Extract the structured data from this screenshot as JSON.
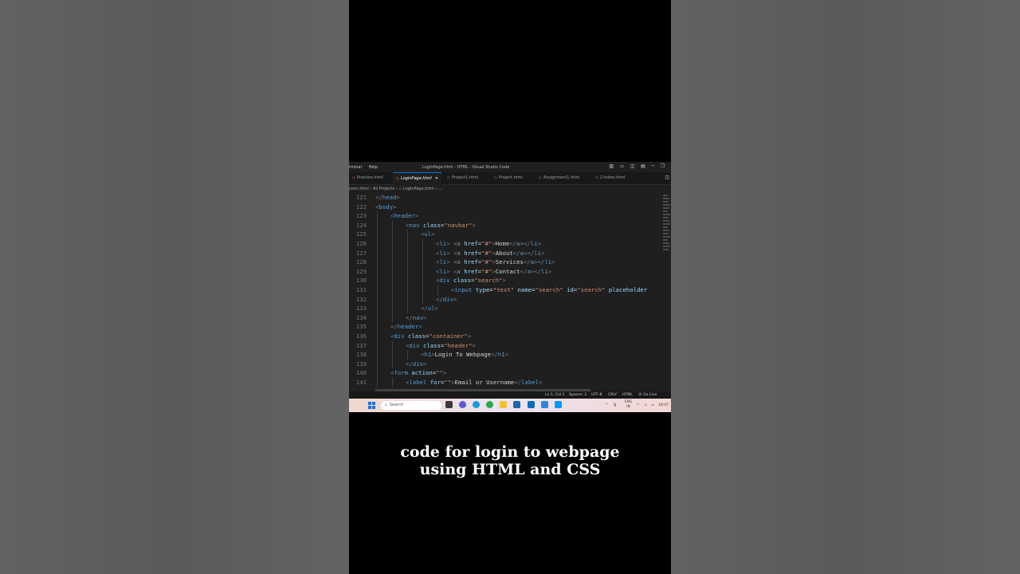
{
  "window": {
    "menu": [
      "rminal",
      "Help"
    ],
    "title": "LoginPage.html - HTML - Visual Studio Code",
    "controls": [
      "▥",
      "▭",
      "◫",
      "▤",
      "─",
      "❐"
    ]
  },
  "tabs": [
    {
      "label": "Practice.html",
      "active": false
    },
    {
      "label": "LoginPage.html",
      "active": true
    },
    {
      "label": "Project1.html",
      "active": false
    },
    {
      "label": "Project.html",
      "active": false
    },
    {
      "label": "Assignment1.html",
      "active": false
    },
    {
      "label": "2-index.html",
      "active": false
    }
  ],
  "breadcrumb": {
    "part1": "conc.html",
    "part2": "All Projects",
    "part3": "LoginPage.html",
    "part4": "..."
  },
  "code": {
    "lines": [
      {
        "n": "121",
        "indent": 0,
        "t": [
          [
            "pn",
            "</"
          ],
          [
            "tg",
            "head"
          ],
          [
            "pn",
            ">"
          ]
        ]
      },
      {
        "n": "122",
        "indent": 0,
        "t": [
          [
            "pn",
            "<"
          ],
          [
            "tg",
            "body"
          ],
          [
            "pn",
            ">"
          ]
        ]
      },
      {
        "n": "123",
        "indent": 1,
        "t": [
          [
            "pn",
            "<"
          ],
          [
            "tg",
            "header"
          ],
          [
            "pn",
            ">"
          ]
        ]
      },
      {
        "n": "124",
        "indent": 2,
        "t": [
          [
            "pn",
            "<"
          ],
          [
            "tg",
            "nav"
          ],
          [
            "tx",
            " "
          ],
          [
            "at",
            "class"
          ],
          [
            "tx",
            "="
          ],
          [
            "st",
            "\"navbar\""
          ],
          [
            "pn",
            ">"
          ]
        ]
      },
      {
        "n": "125",
        "indent": 3,
        "t": [
          [
            "pn",
            "<"
          ],
          [
            "tg",
            "ul"
          ],
          [
            "pn",
            ">"
          ]
        ]
      },
      {
        "n": "126",
        "indent": 4,
        "t": [
          [
            "pn",
            "<"
          ],
          [
            "tg",
            "li"
          ],
          [
            "pn",
            "> <"
          ],
          [
            "tg",
            "a"
          ],
          [
            "tx",
            " "
          ],
          [
            "at",
            "href"
          ],
          [
            "tx",
            "="
          ],
          [
            "st",
            "\"#\""
          ],
          [
            "pn",
            ">"
          ],
          [
            "tx",
            "Home"
          ],
          [
            "pn",
            "</"
          ],
          [
            "tg",
            "a"
          ],
          [
            "pn",
            "></"
          ],
          [
            "tg",
            "li"
          ],
          [
            "pn",
            ">"
          ]
        ]
      },
      {
        "n": "127",
        "indent": 4,
        "t": [
          [
            "pn",
            "<"
          ],
          [
            "tg",
            "li"
          ],
          [
            "pn",
            "> <"
          ],
          [
            "tg",
            "a"
          ],
          [
            "tx",
            " "
          ],
          [
            "at",
            "href"
          ],
          [
            "tx",
            "="
          ],
          [
            "st",
            "\"#\""
          ],
          [
            "pn",
            ">"
          ],
          [
            "tx",
            "About"
          ],
          [
            "pn",
            "</"
          ],
          [
            "tg",
            "a"
          ],
          [
            "pn",
            "></"
          ],
          [
            "tg",
            "li"
          ],
          [
            "pn",
            ">"
          ]
        ]
      },
      {
        "n": "128",
        "indent": 4,
        "t": [
          [
            "pn",
            "<"
          ],
          [
            "tg",
            "li"
          ],
          [
            "pn",
            "> <"
          ],
          [
            "tg",
            "a"
          ],
          [
            "tx",
            " "
          ],
          [
            "at",
            "href"
          ],
          [
            "tx",
            "="
          ],
          [
            "st",
            "\"#\""
          ],
          [
            "pn",
            ">"
          ],
          [
            "tx",
            "Services"
          ],
          [
            "pn",
            "</"
          ],
          [
            "tg",
            "a"
          ],
          [
            "pn",
            "></"
          ],
          [
            "tg",
            "li"
          ],
          [
            "pn",
            ">"
          ]
        ]
      },
      {
        "n": "129",
        "indent": 4,
        "t": [
          [
            "pn",
            "<"
          ],
          [
            "tg",
            "li"
          ],
          [
            "pn",
            "> <"
          ],
          [
            "tg",
            "a"
          ],
          [
            "tx",
            " "
          ],
          [
            "at",
            "href"
          ],
          [
            "tx",
            "="
          ],
          [
            "st",
            "\"#\""
          ],
          [
            "pn",
            ">"
          ],
          [
            "tx",
            "Contact"
          ],
          [
            "pn",
            "</"
          ],
          [
            "tg",
            "a"
          ],
          [
            "pn",
            "></"
          ],
          [
            "tg",
            "li"
          ],
          [
            "pn",
            ">"
          ]
        ]
      },
      {
        "n": "130",
        "indent": 4,
        "t": [
          [
            "pn",
            "<"
          ],
          [
            "tg",
            "div"
          ],
          [
            "tx",
            " "
          ],
          [
            "at",
            "class"
          ],
          [
            "tx",
            "="
          ],
          [
            "st",
            "\"search\""
          ],
          [
            "pn",
            ">"
          ]
        ]
      },
      {
        "n": "131",
        "indent": 5,
        "t": [
          [
            "pn",
            "<"
          ],
          [
            "tg",
            "input"
          ],
          [
            "tx",
            " "
          ],
          [
            "at",
            "type"
          ],
          [
            "tx",
            "="
          ],
          [
            "st",
            "\"text\""
          ],
          [
            "tx",
            " "
          ],
          [
            "at",
            "name"
          ],
          [
            "tx",
            "="
          ],
          [
            "st",
            "\"search\""
          ],
          [
            "tx",
            " "
          ],
          [
            "at",
            "id"
          ],
          [
            "tx",
            "="
          ],
          [
            "st",
            "\"search\""
          ],
          [
            "tx",
            " "
          ],
          [
            "at",
            "placeholder"
          ]
        ]
      },
      {
        "n": "132",
        "indent": 4,
        "t": [
          [
            "pn",
            "</"
          ],
          [
            "tg",
            "div"
          ],
          [
            "pn",
            ">"
          ]
        ]
      },
      {
        "n": "133",
        "indent": 3,
        "t": [
          [
            "pn",
            "</"
          ],
          [
            "tg",
            "ul"
          ],
          [
            "pn",
            ">"
          ]
        ]
      },
      {
        "n": "134",
        "indent": 2,
        "t": [
          [
            "pn",
            "</"
          ],
          [
            "tg",
            "nav"
          ],
          [
            "pn",
            ">"
          ]
        ]
      },
      {
        "n": "135",
        "indent": 1,
        "t": [
          [
            "pn",
            "</"
          ],
          [
            "tg",
            "header"
          ],
          [
            "pn",
            ">"
          ]
        ]
      },
      {
        "n": "136",
        "indent": 1,
        "t": [
          [
            "pn",
            "<"
          ],
          [
            "tg",
            "div"
          ],
          [
            "tx",
            " "
          ],
          [
            "at",
            "class"
          ],
          [
            "tx",
            "="
          ],
          [
            "st",
            "\"container\""
          ],
          [
            "pn",
            ">"
          ]
        ]
      },
      {
        "n": "137",
        "indent": 2,
        "t": [
          [
            "pn",
            "<"
          ],
          [
            "tg",
            "div"
          ],
          [
            "tx",
            " "
          ],
          [
            "at",
            "class"
          ],
          [
            "tx",
            "="
          ],
          [
            "st",
            "\"header\""
          ],
          [
            "pn",
            ">"
          ]
        ]
      },
      {
        "n": "138",
        "indent": 3,
        "t": [
          [
            "pn",
            "<"
          ],
          [
            "tg",
            "h1"
          ],
          [
            "pn",
            ">"
          ],
          [
            "tx",
            "Login To Webpage"
          ],
          [
            "pn",
            "</"
          ],
          [
            "tg",
            "h1"
          ],
          [
            "pn",
            ">"
          ]
        ]
      },
      {
        "n": "139",
        "indent": 2,
        "t": [
          [
            "pn",
            "</"
          ],
          [
            "tg",
            "div"
          ],
          [
            "pn",
            ">"
          ]
        ]
      },
      {
        "n": "140",
        "indent": 1,
        "t": [
          [
            "pn",
            "<"
          ],
          [
            "tg",
            "form"
          ],
          [
            "tx",
            " "
          ],
          [
            "at",
            "action"
          ],
          [
            "tx",
            "="
          ],
          [
            "st",
            "\"\""
          ],
          [
            "pn",
            ">"
          ]
        ]
      },
      {
        "n": "141",
        "indent": 2,
        "t": [
          [
            "pn",
            "<"
          ],
          [
            "tg",
            "label"
          ],
          [
            "tx",
            " "
          ],
          [
            "at",
            "for"
          ],
          [
            "tx",
            "="
          ],
          [
            "st",
            "\"\""
          ],
          [
            "pn",
            ">"
          ],
          [
            "tx",
            "Email or Username"
          ],
          [
            "pn",
            "</"
          ],
          [
            "tg",
            "label"
          ],
          [
            "pn",
            ">"
          ]
        ]
      }
    ]
  },
  "statusbar": {
    "position": "Ln 1, Col 1",
    "spaces": "Spaces: 2",
    "encoding": "UTF-8",
    "eol": "CRLF",
    "language": "HTML",
    "golive": "Go Live"
  },
  "taskbar": {
    "search_placeholder": "Search",
    "lang_top": "ENG",
    "lang_bottom": "IN",
    "time": "16:07"
  },
  "caption": {
    "line1": "code for login to webpage",
    "line2": "using HTML and CSS"
  },
  "colors": {
    "tag": "#569cd6",
    "attr": "#9cdcfe",
    "string": "#ce9178",
    "text": "#d4d4d4",
    "punct": "#808080",
    "html_file_icon": "#e37933"
  }
}
